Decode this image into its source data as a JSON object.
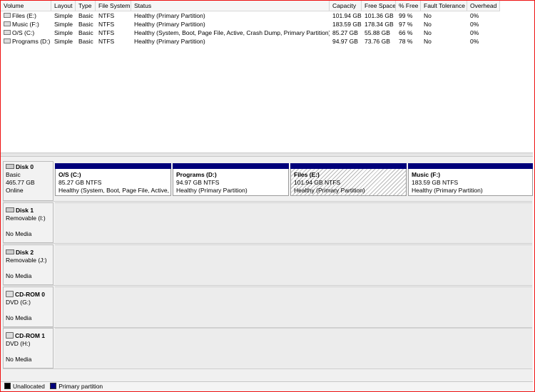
{
  "table": {
    "headers": [
      "Volume",
      "Layout",
      "Type",
      "File System",
      "Status",
      "Capacity",
      "Free Space",
      "% Free",
      "Fault Tolerance",
      "Overhead"
    ],
    "rows": [
      [
        "Files (E:)",
        "Simple",
        "Basic",
        "NTFS",
        "Healthy (Primary Partition)",
        "101.94 GB",
        "101.36 GB",
        "99 %",
        "No",
        "0%"
      ],
      [
        "Music (F:)",
        "Simple",
        "Basic",
        "NTFS",
        "Healthy (Primary Partition)",
        "183.59 GB",
        "178.34 GB",
        "97 %",
        "No",
        "0%"
      ],
      [
        "O/S (C:)",
        "Simple",
        "Basic",
        "NTFS",
        "Healthy (System, Boot, Page File, Active, Crash Dump, Primary Partition)",
        "85.27 GB",
        "55.88 GB",
        "66 %",
        "No",
        "0%"
      ],
      [
        "Programs (D:)",
        "Simple",
        "Basic",
        "NTFS",
        "Healthy (Primary Partition)",
        "94.97 GB",
        "73.76 GB",
        "78 %",
        "No",
        "0%"
      ]
    ]
  },
  "disks": [
    {
      "name": "Disk 0",
      "line1": "Basic",
      "line2": "465.77 GB",
      "line3": "Online",
      "partitions": [
        {
          "name": "O/S  (C:)",
          "size": "85.27 GB NTFS",
          "status": "Healthy (System, Boot, Page File, Active,"
        },
        {
          "name": "Programs  (D:)",
          "size": "94.97 GB NTFS",
          "status": "Healthy (Primary Partition)"
        },
        {
          "name": "Files  (E:)",
          "size": "101.94 GB NTFS",
          "status": "Healthy (Primary Partition)"
        },
        {
          "name": "Music  (F:)",
          "size": "183.59 GB NTFS",
          "status": "Healthy (Primary Partition)"
        }
      ]
    },
    {
      "name": "Disk 1",
      "line1": "Removable (I:)",
      "line2": "",
      "line3": "No Media"
    },
    {
      "name": "Disk 2",
      "line1": "Removable (J:)",
      "line2": "",
      "line3": "No Media"
    },
    {
      "name": "CD-ROM 0",
      "line1": "DVD (G:)",
      "line2": "",
      "line3": "No Media"
    },
    {
      "name": "CD-ROM 1",
      "line1": "DVD (H:)",
      "line2": "",
      "line3": "No Media"
    }
  ],
  "legend": {
    "unallocated": "Unallocated",
    "primary": "Primary partition",
    "unallocated_color": "#000000",
    "primary_color": "#00007a"
  }
}
